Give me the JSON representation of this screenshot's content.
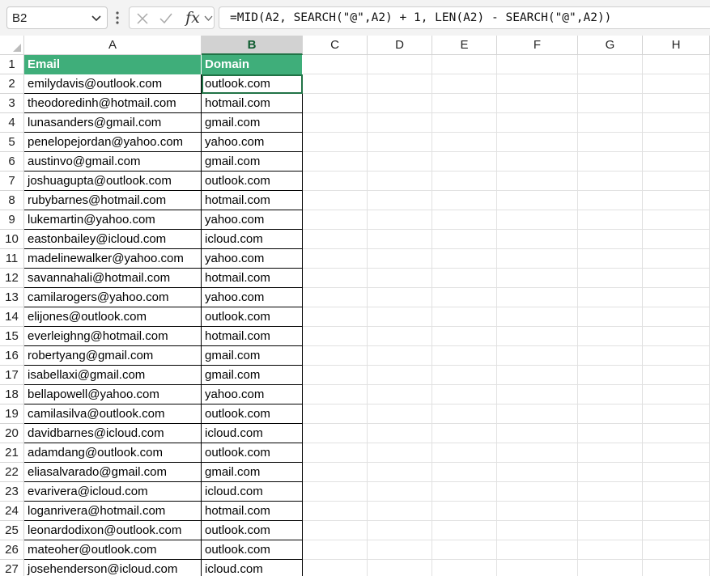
{
  "formula_bar": {
    "name_box": "B2",
    "fx_label": "fx",
    "formula": "=MID(A2, SEARCH(\"@\",A2) + 1, LEN(A2) - SEARCH(\"@\",A2))"
  },
  "columns": [
    "A",
    "B",
    "C",
    "D",
    "E",
    "F",
    "G",
    "H"
  ],
  "selected_column": "B",
  "active_cell": "B2",
  "header": {
    "email": "Email",
    "domain": "Domain"
  },
  "rows": [
    {
      "num": "1"
    },
    {
      "num": "2",
      "email": "emilydavis@outlook.com",
      "domain": "outlook.com"
    },
    {
      "num": "3",
      "email": "theodoredinh@hotmail.com",
      "domain": "hotmail.com"
    },
    {
      "num": "4",
      "email": "lunasanders@gmail.com",
      "domain": "gmail.com"
    },
    {
      "num": "5",
      "email": "penelopejordan@yahoo.com",
      "domain": "yahoo.com"
    },
    {
      "num": "6",
      "email": "austinvo@gmail.com",
      "domain": "gmail.com"
    },
    {
      "num": "7",
      "email": "joshuagupta@outlook.com",
      "domain": "outlook.com"
    },
    {
      "num": "8",
      "email": "rubybarnes@hotmail.com",
      "domain": "hotmail.com"
    },
    {
      "num": "9",
      "email": "lukemartin@yahoo.com",
      "domain": "yahoo.com"
    },
    {
      "num": "10",
      "email": "eastonbailey@icloud.com",
      "domain": "icloud.com"
    },
    {
      "num": "11",
      "email": "madelinewalker@yahoo.com",
      "domain": "yahoo.com"
    },
    {
      "num": "12",
      "email": "savannahali@hotmail.com",
      "domain": "hotmail.com"
    },
    {
      "num": "13",
      "email": "camilarogers@yahoo.com",
      "domain": "yahoo.com"
    },
    {
      "num": "14",
      "email": "elijones@outlook.com",
      "domain": "outlook.com"
    },
    {
      "num": "15",
      "email": "everleighng@hotmail.com",
      "domain": "hotmail.com"
    },
    {
      "num": "16",
      "email": "robertyang@gmail.com",
      "domain": "gmail.com"
    },
    {
      "num": "17",
      "email": "isabellaxi@gmail.com",
      "domain": "gmail.com"
    },
    {
      "num": "18",
      "email": "bellapowell@yahoo.com",
      "domain": "yahoo.com"
    },
    {
      "num": "19",
      "email": "camilasilva@outlook.com",
      "domain": "outlook.com"
    },
    {
      "num": "20",
      "email": "davidbarnes@icloud.com",
      "domain": "icloud.com"
    },
    {
      "num": "21",
      "email": "adamdang@outlook.com",
      "domain": "outlook.com"
    },
    {
      "num": "22",
      "email": "eliasalvarado@gmail.com",
      "domain": "gmail.com"
    },
    {
      "num": "23",
      "email": "evarivera@icloud.com",
      "domain": "icloud.com"
    },
    {
      "num": "24",
      "email": "loganrivera@hotmail.com",
      "domain": "hotmail.com"
    },
    {
      "num": "25",
      "email": "leonardodixon@outlook.com",
      "domain": "outlook.com"
    },
    {
      "num": "26",
      "email": "mateoher@outlook.com",
      "domain": "outlook.com"
    },
    {
      "num": "27",
      "email": "josehenderson@icloud.com",
      "domain": "icloud.com"
    }
  ],
  "colors": {
    "header_fill": "#3fae7a",
    "selection_accent": "#217346",
    "selected_header": "#d2d2d2"
  },
  "icons": {
    "name_box_dropdown": "chevron-down-icon",
    "more_options": "kebab-icon",
    "cancel": "close-icon",
    "enter": "check-icon",
    "insert_function": "fx-icon",
    "expand": "chevron-down-icon",
    "select_all": "select-all-triangle-icon"
  }
}
